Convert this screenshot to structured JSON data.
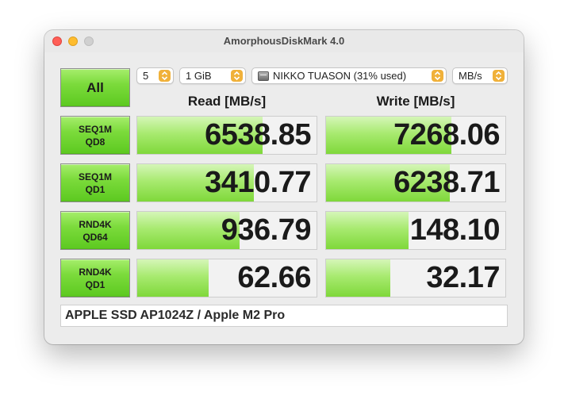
{
  "window": {
    "title": "AmorphousDiskMark 4.0"
  },
  "controls": {
    "all_label": "All",
    "count": "5",
    "size": "1 GiB",
    "disk": "NIKKO TUASON (31% used)",
    "unit": "MB/s"
  },
  "columns": {
    "read": "Read [MB/s]",
    "write": "Write [MB/s]"
  },
  "tests": [
    {
      "line1": "SEQ1M",
      "line2": "QD8",
      "read": "6538.85",
      "write": "7268.06",
      "read_fill": 0.7,
      "write_fill": 0.7
    },
    {
      "line1": "SEQ1M",
      "line2": "QD1",
      "read": "3410.77",
      "write": "6238.71",
      "read_fill": 0.65,
      "write_fill": 0.69
    },
    {
      "line1": "RND4K",
      "line2": "QD64",
      "read": "936.79",
      "write": "148.10",
      "read_fill": 0.57,
      "write_fill": 0.46
    },
    {
      "line1": "RND4K",
      "line2": "QD1",
      "read": "62.66",
      "write": "32.17",
      "read_fill": 0.4,
      "write_fill": 0.36
    }
  ],
  "footer": "APPLE SSD AP1024Z / Apple M2 Pro",
  "colors": {
    "accent_green": "#7cdb3c",
    "bar_green": "#a8ea70",
    "stepper_orange": "#f0b13a"
  }
}
